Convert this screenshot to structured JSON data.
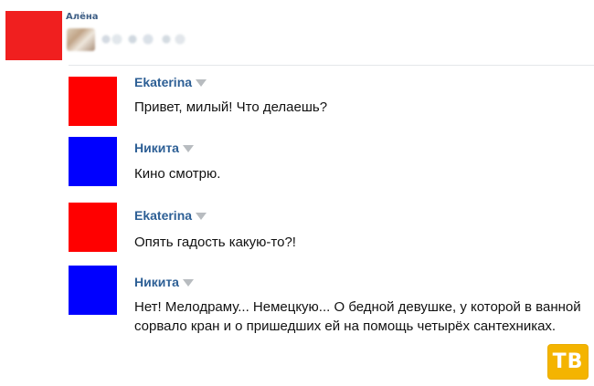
{
  "header": {
    "name": "Алёна",
    "avatar_color": "#f01f1f"
  },
  "messages": [
    {
      "author": "Ekaterina",
      "text": "Привет, милый! Что делаешь?",
      "avatar_color": "#ff0000"
    },
    {
      "author": "Никита",
      "text": "Кино смотрю.",
      "avatar_color": "#0000ff"
    },
    {
      "author": "Ekaterina",
      "text": "Опять  гадость какую-то?!",
      "avatar_color": "#ff0000"
    },
    {
      "author": "Никита",
      "text": "Нет! Мелодраму... Немецкую... О бедной девушке, у которой в ванной сорвало кран и о пришедших ей на помощь четырёх сантехниках.",
      "avatar_color": "#0000ff"
    }
  ],
  "watermark": {
    "label": "ТВ",
    "color": "#f4b400"
  },
  "icons": {
    "author_menu": "chevron-down-icon"
  }
}
